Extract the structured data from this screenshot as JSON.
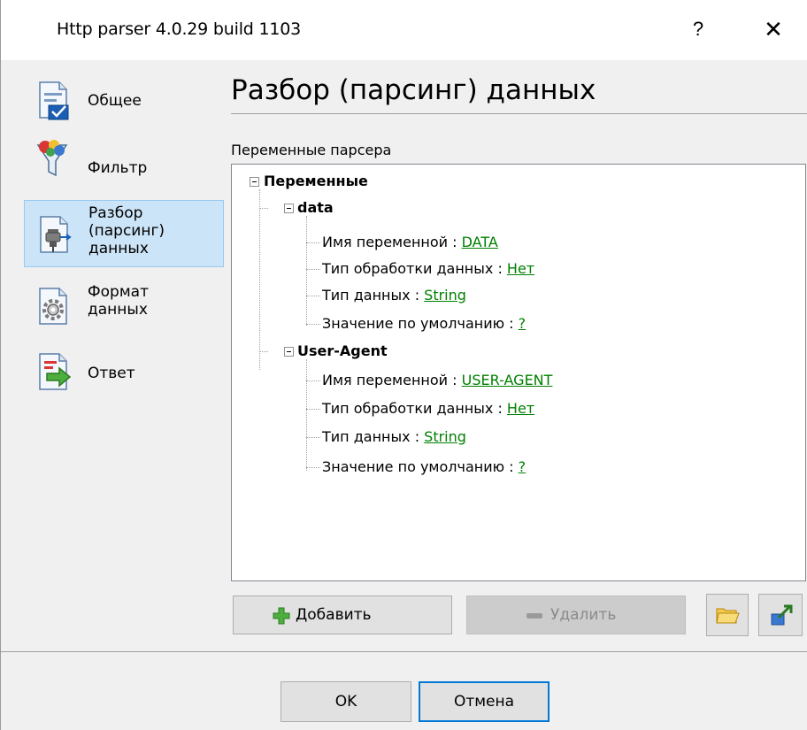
{
  "window": {
    "title": "Http parser 4.0.29 build 1103",
    "help_label": "?",
    "close_label": "✕"
  },
  "sidebar": {
    "items": [
      {
        "label": "Общее",
        "icon": "general-icon"
      },
      {
        "label": "Фильтр",
        "icon": "filter-icon"
      },
      {
        "label": "Разбор\n(парсинг)\nданных",
        "icon": "parsing-icon",
        "selected": true
      },
      {
        "label": "Формат\nданных",
        "icon": "data-format-icon"
      },
      {
        "label": "Ответ",
        "icon": "response-icon"
      }
    ]
  },
  "main": {
    "page_title": "Разбор (парсинг) данных",
    "vars_label": "Переменные парсера",
    "tree": {
      "root": "Переменные",
      "groups": [
        {
          "name": "data",
          "props": [
            {
              "label": "Имя переменной : ",
              "value": "DATA"
            },
            {
              "label": "Тип обработки данных : ",
              "value": "Нет"
            },
            {
              "label": "Тип данных : ",
              "value": "String"
            },
            {
              "label": "Значение по умолчанию : ",
              "value": "?"
            }
          ]
        },
        {
          "name": "User-Agent",
          "props": [
            {
              "label": "Имя переменной : ",
              "value": "USER-AGENT"
            },
            {
              "label": "Тип обработки данных : ",
              "value": "Нет"
            },
            {
              "label": "Тип данных : ",
              "value": "String"
            },
            {
              "label": "Значение по умолчанию : ",
              "value": "?"
            }
          ]
        }
      ]
    },
    "add_label": "Добавить",
    "delete_label": "Удалить"
  },
  "footer": {
    "ok_label": "OK",
    "cancel_label": "Отмена"
  },
  "colors": {
    "accent": "#0078d7",
    "selection": "#cce4f7",
    "value_link": "#008000"
  }
}
